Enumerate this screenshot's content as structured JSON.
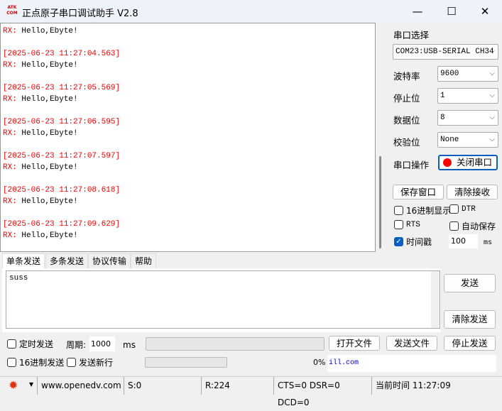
{
  "window": {
    "title": "正点原子串口调试助手 V2.8",
    "logo_text": "ATK COM",
    "minimize": "—",
    "maximize": "☐",
    "close": "✕"
  },
  "receive": {
    "first_line": {
      "prefix": "RX:",
      "text": " Hello,Ebyte!"
    },
    "entries": [
      {
        "timestamp": "[2025-06-23 11:27:04.563]",
        "prefix": "RX:",
        "text": " Hello,Ebyte!"
      },
      {
        "timestamp": "[2025-06-23 11:27:05.569]",
        "prefix": "RX:",
        "text": " Hello,Ebyte!"
      },
      {
        "timestamp": "[2025-06-23 11:27:06.595]",
        "prefix": "RX:",
        "text": " Hello,Ebyte!"
      },
      {
        "timestamp": "[2025-06-23 11:27:07.597]",
        "prefix": "RX:",
        "text": " Hello,Ebyte!"
      },
      {
        "timestamp": "[2025-06-23 11:27:08.618]",
        "prefix": "RX:",
        "text": " Hello,Ebyte!"
      },
      {
        "timestamp": "[2025-06-23 11:27:09.629]",
        "prefix": "RX:",
        "text": " Hello,Ebyte!"
      }
    ]
  },
  "settings": {
    "port_select_label": "串口选择",
    "port_value": "COM23:USB-SERIAL CH34",
    "baud_label": "波特率",
    "baud_value": "9600",
    "stop_label": "停止位",
    "stop_value": "1",
    "data_label": "数据位",
    "data_value": "8",
    "parity_label": "校验位",
    "parity_value": "None",
    "op_label": "串口操作",
    "close_port": "关闭串口",
    "save_window": "保存窗口",
    "clear_receive": "清除接收",
    "hex_display": "16进制显示",
    "dtr": "DTR",
    "rts": "RTS",
    "auto_save": "自动保存",
    "timestamp": "时间戳",
    "timestamp_ms": "100",
    "ms": "ms"
  },
  "tabs": [
    "单条发送",
    "多条发送",
    "协议传输",
    "帮助"
  ],
  "send": {
    "text": "suss",
    "send_button": "发送",
    "clear_send": "清除发送",
    "timed_send": "定时发送",
    "period_label": "周期:",
    "period_value": "1000",
    "ms": "ms",
    "open_file": "打开文件",
    "send_file": "发送文件",
    "stop_send": "停止发送",
    "hex_send": "16进制发送",
    "send_newline": "发送新行",
    "progress": "0%",
    "link_text": "ill.com"
  },
  "status": {
    "website": "www.openedv.com",
    "sent": "S:0",
    "received": "R:224",
    "lines": "CTS=0 DSR=0 DCD=0",
    "time": "当前时间 11:27:09"
  }
}
